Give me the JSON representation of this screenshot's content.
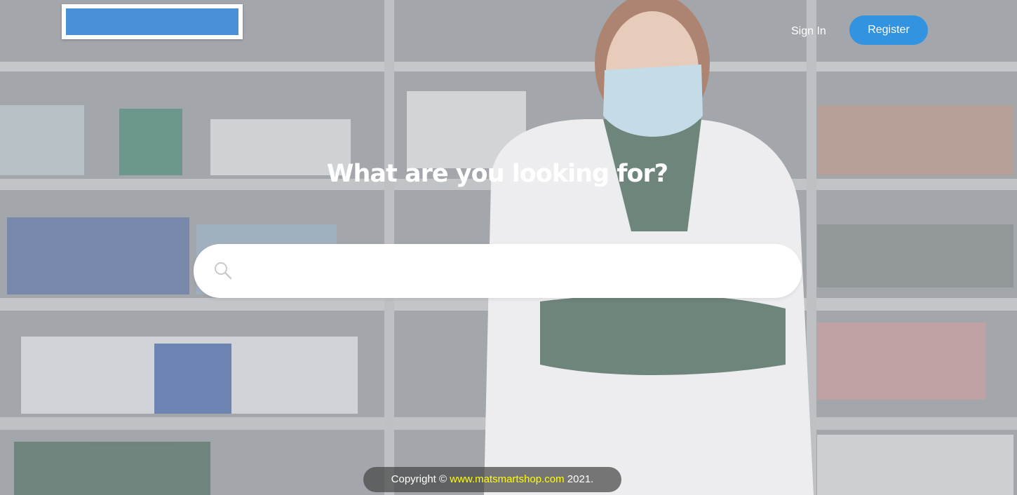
{
  "header": {
    "signin_label": "Sign In",
    "register_label": "Register"
  },
  "hero": {
    "headline": "What are you looking for?"
  },
  "search": {
    "value": "",
    "placeholder": "",
    "icon": "search-icon"
  },
  "footer": {
    "copyright_prefix": "Copyright ©",
    "site_link": "www.matsmartshop.com",
    "year_suffix": "2021."
  },
  "colors": {
    "accent": "#3293e0",
    "logo_placeholder": "#4a90d9",
    "footer_link": "#ffff00"
  }
}
